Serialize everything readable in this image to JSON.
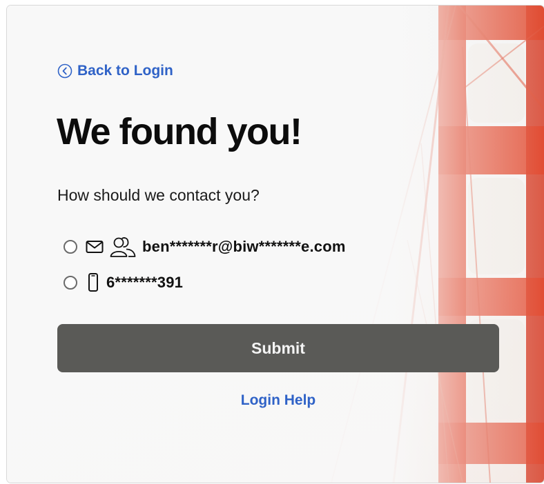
{
  "nav": {
    "back_label": "Back to Login"
  },
  "heading": {
    "title": "We found you!"
  },
  "prompt": {
    "question": "How should we contact you?"
  },
  "contact_options": [
    {
      "type": "email",
      "icon": "envelope-icon",
      "icon2": "users-icon",
      "value": "ben*******r@biw*******e.com",
      "selected": false
    },
    {
      "type": "phone",
      "icon": "phone-icon",
      "value": "6*******391",
      "selected": false
    }
  ],
  "actions": {
    "submit_label": "Submit",
    "help_label": "Login Help"
  },
  "colors": {
    "link": "#2f62c7",
    "button_bg": "#5a5a57",
    "bridge": "#d9442c"
  }
}
